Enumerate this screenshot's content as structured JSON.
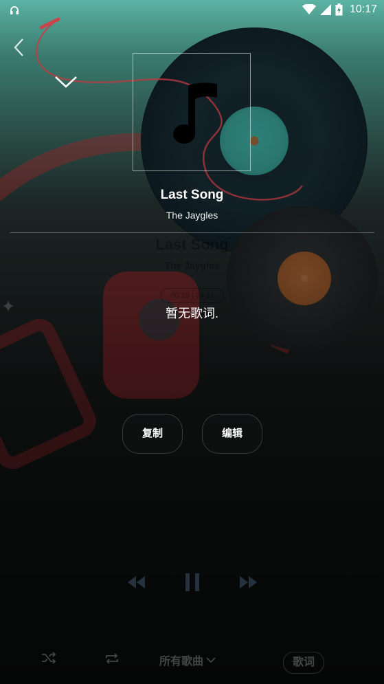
{
  "status_bar": {
    "time": "10:17",
    "icons": [
      "headphones-icon",
      "wifi-icon",
      "cell-signal-icon",
      "battery-icon"
    ]
  },
  "nav": {
    "back_icon": "chevron-left-icon",
    "collapse_icon": "chevron-down-icon"
  },
  "song": {
    "title": "Last Song",
    "artist": "The Jaygles"
  },
  "background_text": {
    "title": "Last Song",
    "artist": "The Jaygles",
    "time": "00:15 | 04:11"
  },
  "lyrics": {
    "empty_message": "暂无歌词."
  },
  "actions": {
    "copy_label": "复制",
    "edit_label": "编辑"
  },
  "playback": {
    "prev_icon": "rewind-icon",
    "pause_icon": "pause-icon",
    "next_icon": "fast-forward-icon"
  },
  "bottom_bar": {
    "shuffle_icon": "shuffle-icon",
    "repeat_icon": "repeat-icon",
    "playlist_label": "所有歌曲",
    "lyrics_tab_label": "歌词"
  },
  "colors": {
    "top_gradient": "#5bb3a4",
    "background_dark": "#0f1212",
    "text": "#ffffff"
  }
}
